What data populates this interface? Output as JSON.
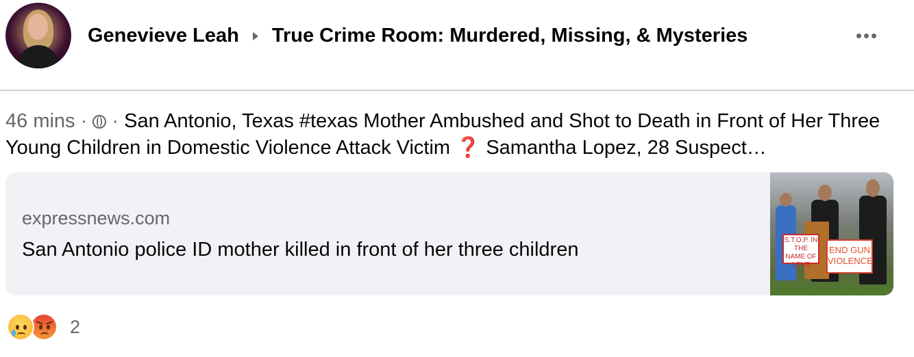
{
  "post": {
    "author": "Genevieve Leah",
    "group": "True Crime Room: Murdered, Missing, & Mysteries",
    "time": "46 mins",
    "privacy_icon": "globe-icon",
    "text_part1": "San Antonio, Texas #texas Mother Ambushed and Shot to Death in Front of Her Three Young Children in Domestic Violence Attack Victim",
    "text_emoji": "❓",
    "text_part2": "Samantha Lopez, 28 Suspect…"
  },
  "link_preview": {
    "domain": "expressnews.com",
    "headline": "San Antonio police ID mother killed in front of her three children",
    "sign1_text": "S.T.O.P. IN THE NAME OF LOVE",
    "sign2_text": "END GUN VIOLENCE"
  },
  "reactions": {
    "types": [
      "sad",
      "angry"
    ],
    "count": "2"
  }
}
